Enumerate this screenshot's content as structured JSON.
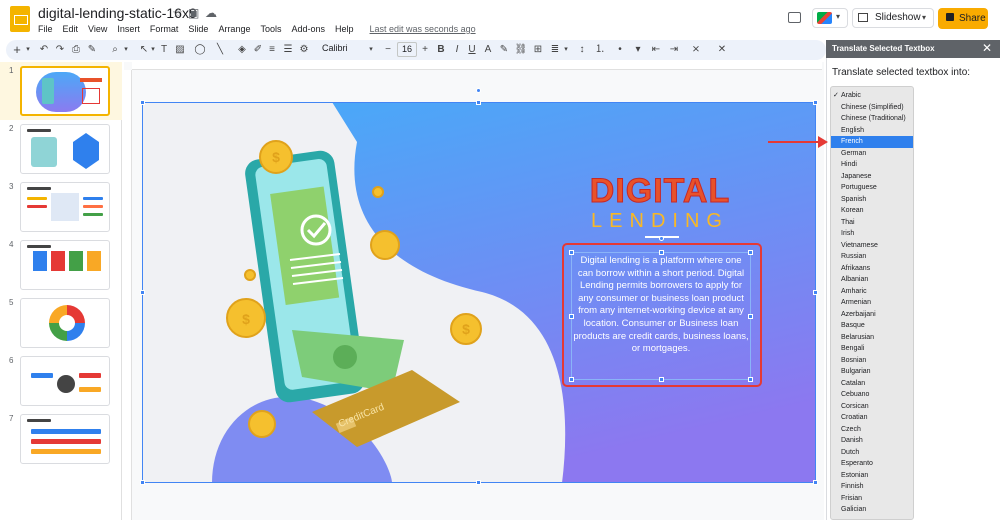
{
  "app": {
    "doc_title": "digital-lending-static-16x9",
    "menu": [
      "File",
      "Edit",
      "View",
      "Insert",
      "Format",
      "Slide",
      "Arrange",
      "Tools",
      "Add-ons",
      "Help"
    ],
    "last_edit": "Last edit was seconds ago",
    "slideshow_label": "Slideshow",
    "share_label": "Share"
  },
  "toolbar": {
    "font_name": "Calibri",
    "font_size": "16"
  },
  "filmstrip": {
    "slide_numbers": [
      "1",
      "2",
      "3",
      "4",
      "5",
      "6",
      "7"
    ],
    "selected": "1"
  },
  "slide": {
    "title_line1": "DIGITAL",
    "title_line2": "LENDING",
    "body": "Digital lending is a platform where one can borrow within a short period. Digital Lending permits borrowers to apply for any consumer or business loan product from any internet-working device at any location. Consumer or Business loan products are credit cards, business loans, or mortgages.",
    "card_text": "CreditCard",
    "coin_symbol": "$"
  },
  "panel": {
    "title": "Translate Selected Textbox",
    "close": "✕",
    "label": "Translate selected textbox into:",
    "languages": [
      "Arabic",
      "Chinese (Simplified)",
      "Chinese (Traditional)",
      "English",
      "French",
      "German",
      "Hindi",
      "Japanese",
      "Portuguese",
      "Spanish",
      "Korean",
      "Thai",
      "Irish",
      "Vietnamese",
      "Russian",
      "Afrikaans",
      "Albanian",
      "Amharic",
      "Armenian",
      "Azerbaijani",
      "Basque",
      "Belarusian",
      "Bengali",
      "Bosnian",
      "Bulgarian",
      "Catalan",
      "Cebuano",
      "Corsican",
      "Croatian",
      "Czech",
      "Danish",
      "Dutch",
      "Esperanto",
      "Estonian",
      "Finnish",
      "Frisian",
      "Galician"
    ],
    "checked": "Arabic",
    "highlighted": "French"
  },
  "colors": {
    "accent_yellow": "#f4b400",
    "share_yellow": "#f9ab00",
    "selection_blue": "#4285f4",
    "annotation_red": "#e53935",
    "title_orange": "#e8522a",
    "lending_gold": "#f9b825"
  }
}
